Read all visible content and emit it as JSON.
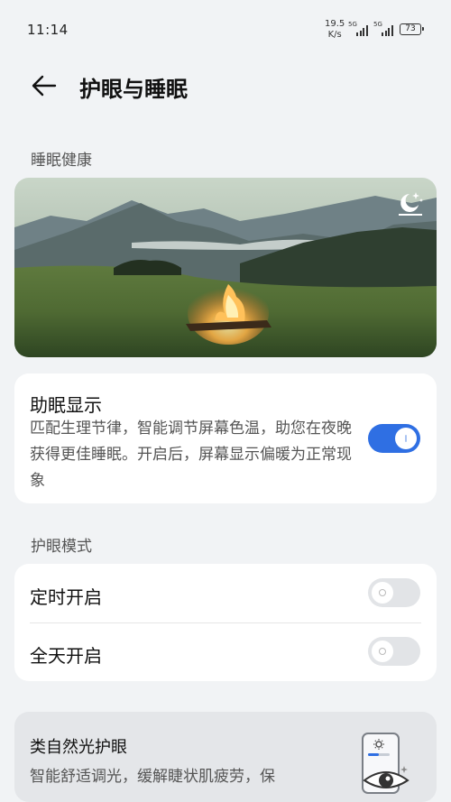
{
  "status_bar": {
    "time": "11:14",
    "net_speed_value": "19.5",
    "net_speed_unit": "K/s",
    "sim1_tag": "5G",
    "sim2_tag": "5G",
    "battery": "73"
  },
  "header": {
    "title": "护眼与睡眠",
    "back_icon": "arrow-left-icon"
  },
  "sleep_section": {
    "label": "睡眠健康",
    "hero_icon": "moon-stars-icon"
  },
  "sleep_display": {
    "title": "助眠显示",
    "description": "匹配生理节律，智能调节屏幕色温，助您在夜晚获得更佳睡眠。开启后，屏幕显示偏暖为正常现象",
    "enabled": true
  },
  "eye_mode_section": {
    "label": "护眼模式",
    "items": [
      {
        "label": "定时开启",
        "enabled": false
      },
      {
        "label": "全天开启",
        "enabled": false
      }
    ]
  },
  "natural_light": {
    "title": "类自然光护眼",
    "description": "智能舒适调光，缓解睫状肌疲劳，保"
  },
  "colors": {
    "background": "#f1f3f5",
    "accent": "#2f6fe3",
    "card": "#ffffff"
  }
}
